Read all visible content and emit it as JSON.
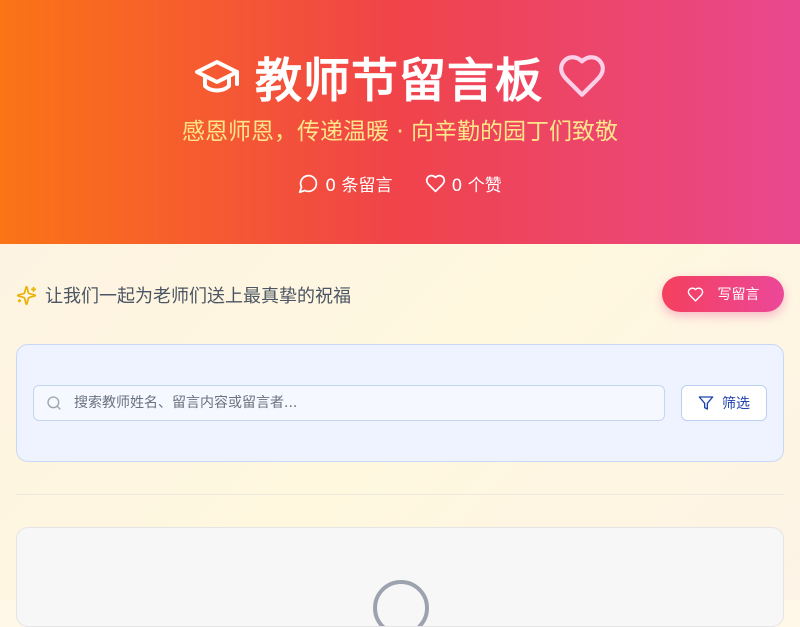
{
  "header": {
    "title": "教师节留言板",
    "subtitle": "感恩师恩，传递温暖 · 向辛勤的园丁们致敬",
    "stats": {
      "messages": "0 条留言",
      "likes": "0 个赞"
    }
  },
  "toolbar": {
    "tagline": "让我们一起为老师们送上最真挚的祝福",
    "write_button": "写留言"
  },
  "search": {
    "placeholder": "搜索教师姓名、留言内容或留言者...",
    "value": "",
    "filter_button": "筛选"
  },
  "icons": {
    "title_left": "graduation-cap-icon",
    "title_right": "heart-icon",
    "messages": "message-circle-icon",
    "likes": "heart-icon",
    "tagline": "sparkles-icon",
    "write": "heart-icon",
    "search": "search-icon",
    "filter": "filter-icon",
    "empty": "message-circle-icon"
  },
  "colors": {
    "hero_start": "#fb7415",
    "hero_mid": "#f0434a",
    "hero_end": "#e9488f",
    "subtitle": "#fde68a",
    "accent": "#f43f5e",
    "filter_text": "#1e40af"
  }
}
